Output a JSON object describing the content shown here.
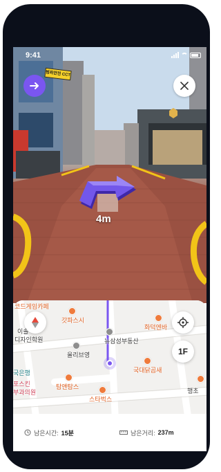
{
  "status_bar": {
    "time": "9:41"
  },
  "camera": {
    "shop_sign": "범죄안전 CCTV",
    "distance_label": "4m"
  },
  "map": {
    "labels": {
      "game_cafe": "코드게임카페",
      "gatposi": "갓파스시",
      "design_academy_1": "이솔",
      "design_academy_2": "디자인학원",
      "olive_young": "올리브영",
      "real_estate": "뉴삼성부동산",
      "hwadeok": "화덕엔바",
      "bank": "국은행",
      "gukdae": "국대닭곰새",
      "dermatology_1": "포스킨",
      "dermatology_2": "부과의원",
      "tamyeon": "탐앤탐스",
      "starbucks": "스타벅스",
      "hanchoe": "행초"
    },
    "floor_button": "1F"
  },
  "info_bar": {
    "time_label": "남은시간:",
    "time_value": "15분",
    "distance_label": "남은거리:",
    "distance_value": "237m"
  },
  "colors": {
    "accent": "#7a56f0",
    "map_background": "#f2f1ef"
  },
  "icons": {
    "nav": "arrow-right-icon",
    "close": "close-icon",
    "compass": "compass-icon",
    "locate": "crosshair-icon",
    "clock": "clock-icon",
    "route": "ruler-icon"
  }
}
